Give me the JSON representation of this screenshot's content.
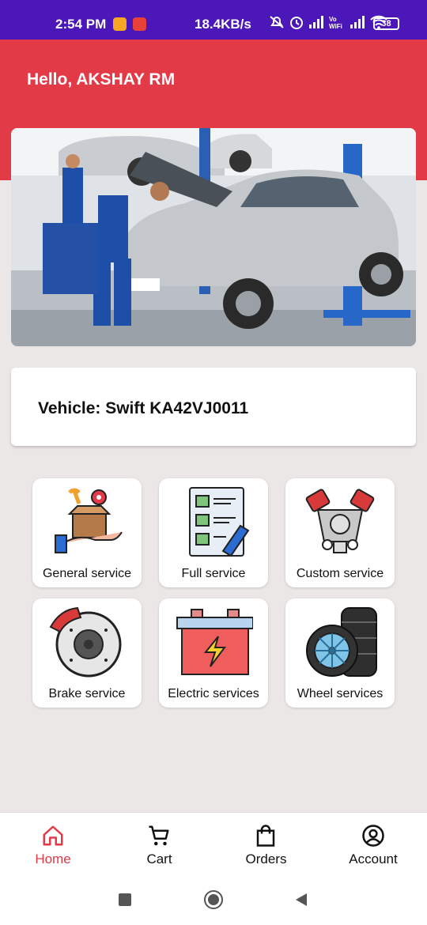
{
  "status_bar": {
    "time": "2:54 PM",
    "net_speed": "18.4KB/s",
    "battery": "38"
  },
  "header": {
    "greeting": "Hello, AKSHAY RM"
  },
  "vehicle": {
    "text": "Vehicle: Swift KA42VJ0011"
  },
  "services": [
    {
      "label": "General service",
      "icon": "hand-box-tools-icon"
    },
    {
      "label": "Full service",
      "icon": "checklist-icon"
    },
    {
      "label": "Custom service",
      "icon": "engine-icon"
    },
    {
      "label": "Brake service",
      "icon": "brake-disc-icon"
    },
    {
      "label": "Electric services",
      "icon": "battery-icon"
    },
    {
      "label": "Wheel services",
      "icon": "tire-icon"
    }
  ],
  "bottom_nav": [
    {
      "label": "Home",
      "icon": "home-icon",
      "active": true
    },
    {
      "label": "Cart",
      "icon": "cart-icon",
      "active": false
    },
    {
      "label": "Orders",
      "icon": "bag-icon",
      "active": false
    },
    {
      "label": "Account",
      "icon": "account-icon",
      "active": false
    }
  ],
  "colors": {
    "accent": "#e33a48",
    "status_bar": "#4b17b8",
    "background": "#ebe7e6"
  }
}
